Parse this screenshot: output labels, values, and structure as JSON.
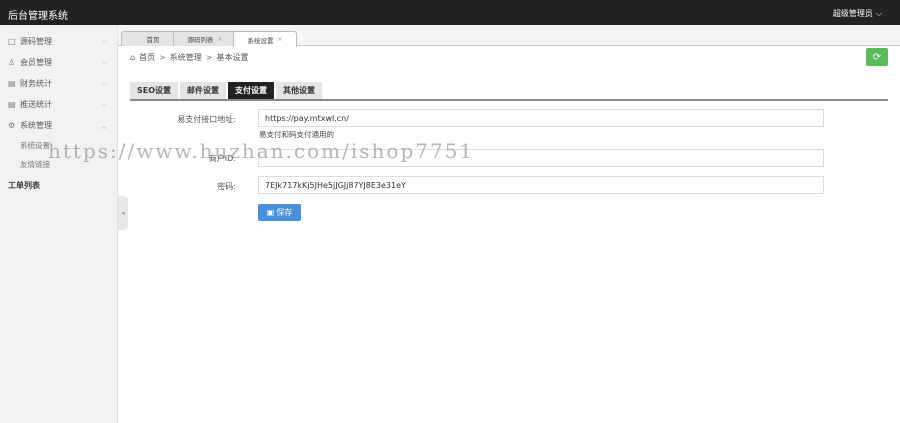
{
  "header": {
    "brand": "后台管理系统",
    "user_label": "超级管理员",
    "user_chevron": "⌵"
  },
  "sidebar": {
    "items": [
      {
        "label": "源码管理",
        "icon": "□"
      },
      {
        "label": "会员管理",
        "icon": "♙"
      },
      {
        "label": "财务统计",
        "icon": "▤"
      },
      {
        "label": "推送统计",
        "icon": "▤"
      },
      {
        "label": "系统管理",
        "icon": "⚙"
      }
    ],
    "sub_items": [
      {
        "label": "系统设置"
      },
      {
        "label": "友情链接"
      }
    ],
    "plain_item": "工单列表",
    "chevron_down": "⌵",
    "chevron_up": "︿",
    "collapse_arrow": "◂"
  },
  "page_tabs": [
    {
      "label": "首页"
    },
    {
      "label": "源码列表",
      "close": "×"
    },
    {
      "label": "系统设置",
      "close": "×"
    }
  ],
  "breadcrumb": {
    "home_icon": "⌂",
    "home": "首页",
    "sep": ">",
    "level1": "系统管理",
    "level2": "基本设置"
  },
  "refresh_icon": "⟳",
  "settings_tabs": [
    {
      "label": "SEO设置"
    },
    {
      "label": "邮件设置"
    },
    {
      "label": "支付设置"
    },
    {
      "label": "其他设置"
    }
  ],
  "form": {
    "api_label": "易支付接口地址:",
    "api_value": "https://pay.mtxwl.cn/",
    "api_hint": "易支付和码支付通用的",
    "merchant_label": "商户ID:",
    "merchant_value": "",
    "key_label": "密码:",
    "key_value": "7EJk717kKj5JHe5jJGJj87YJ8E3e31eY",
    "save_icon": "▣",
    "save_label": "保存"
  },
  "watermark": "https://www.huzhan.com/ishop7751",
  "colors": {
    "topbar": "#222222",
    "refresh": "#5cb85c",
    "save": "#4a90d9",
    "active_tab": "#222222"
  }
}
